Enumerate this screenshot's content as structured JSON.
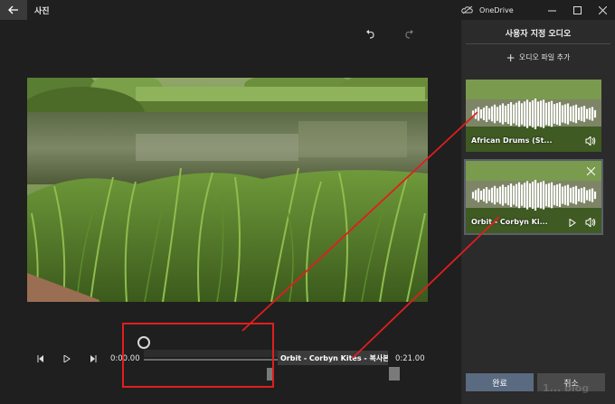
{
  "titlebar": {
    "app_title": "사진",
    "onedrive_label": "OneDrive"
  },
  "timeline": {
    "time_start": "0:00.00",
    "time_end": "0:21.00",
    "audio_clip_label": "Orbit - Corbyn Kites - 복사본"
  },
  "panel": {
    "title": "사용자 지정 오디오",
    "add_audio_label": "오디오 파일 추가",
    "cards": [
      {
        "title": "African Drums (St..."
      },
      {
        "title": "Orbit - Corbyn Ki..."
      }
    ],
    "done_label": "완료",
    "cancel_label": "취소"
  },
  "watermark": "1... blog",
  "colors": {
    "annotation": "#e01e1e",
    "done_button": "#5a6a80"
  },
  "icons": [
    "back-arrow-icon",
    "onedrive-cloud-icon",
    "minimize-icon",
    "maximize-icon",
    "close-icon",
    "undo-icon",
    "redo-icon",
    "skip-back-icon",
    "play-icon",
    "skip-forward-icon",
    "plus-icon",
    "speaker-icon",
    "play-icon",
    "remove-icon"
  ]
}
